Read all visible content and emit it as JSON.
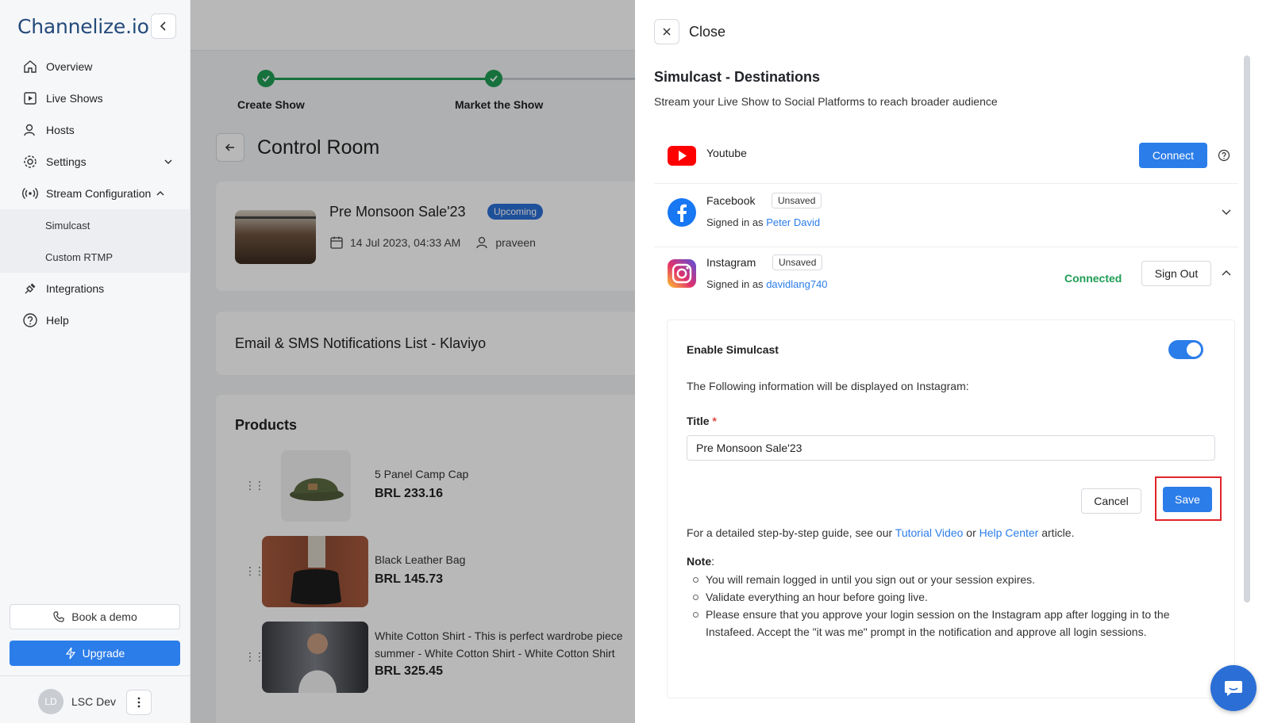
{
  "sidebar": {
    "logo": "Channelize.io",
    "items": [
      {
        "label": "Overview"
      },
      {
        "label": "Live Shows"
      },
      {
        "label": "Hosts"
      },
      {
        "label": "Settings"
      },
      {
        "label": "Stream Configuration"
      },
      {
        "label": "Integrations"
      },
      {
        "label": "Help"
      }
    ],
    "sub_items": [
      {
        "label": "Simulcast"
      },
      {
        "label": "Custom RTMP"
      }
    ],
    "book_demo": "Book a demo",
    "upgrade": "Upgrade",
    "user_initials": "LD",
    "user_name": "LSC Dev"
  },
  "main": {
    "steps": [
      {
        "label": "Create Show"
      },
      {
        "label": "Market the Show"
      }
    ],
    "page_title": "Control Room",
    "show": {
      "name": "Pre Monsoon Sale'23",
      "status": "Upcoming",
      "datetime": "14 Jul 2023, 04:33 AM",
      "host": "praveen"
    },
    "email_list_title": "Email & SMS Notifications List - Klaviyo",
    "products_title": "Products",
    "products": [
      {
        "name": "5 Panel Camp Cap",
        "price": "BRL 233.16"
      },
      {
        "name": "Black Leather Bag",
        "price": "BRL 145.73"
      },
      {
        "name": "White Cotton Shirt - This is perfect wardrobe piece",
        "name_line2": "summer - White Cotton Shirt - White Cotton Shirt",
        "price": "BRL 325.45"
      }
    ]
  },
  "drawer": {
    "close_label": "Close",
    "title": "Simulcast - Destinations",
    "subtitle": "Stream your Live Show to Social Platforms to reach broader audience",
    "youtube": {
      "name": "Youtube",
      "connect": "Connect"
    },
    "facebook": {
      "name": "Facebook",
      "badge": "Unsaved",
      "signed_prefix": "Signed in as",
      "user": "Peter David"
    },
    "instagram": {
      "name": "Instagram",
      "badge": "Unsaved",
      "signed_prefix": "Signed in as",
      "user": "davidlang740",
      "status": "Connected",
      "sign_out": "Sign Out",
      "enable_label": "Enable Simulcast",
      "info": "The Following information will be displayed on Instagram:",
      "title_label": "Title",
      "title_required": "*",
      "title_value": "Pre Monsoon Sale'23",
      "cancel": "Cancel",
      "save": "Save",
      "guide_prefix": "For a detailed step-by-step guide, see our",
      "tutorial_link": "Tutorial Video",
      "guide_or": "or",
      "help_link": "Help Center",
      "guide_suffix": "article.",
      "note_label": "Note",
      "note_colon": ":",
      "notes": [
        "You will remain logged in until you sign out or your session expires.",
        "Validate everything an hour before going live.",
        "Please ensure that you approve your login session on the Instagram app after logging in to the Instafeed. Accept the \"it was me\" prompt in the notification and approve all login sessions."
      ]
    }
  },
  "colors": {
    "accent": "#2b7de9",
    "success": "#1f9d55",
    "youtube": "#ff0000",
    "facebook": "#1877f2",
    "highlight": "#e0242a"
  }
}
